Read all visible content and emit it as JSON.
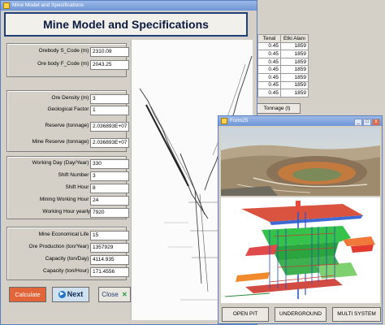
{
  "main_window": {
    "title": "Mine Model and Specifications",
    "heading": "Mine Model and Specifications"
  },
  "fields": {
    "orebody_s_code": {
      "label": "Orebody S_Code (m) :",
      "value": "2310.09"
    },
    "orebody_f_code": {
      "label": "Ore body F_Code (m) :",
      "value": "2043.25"
    },
    "ore_density": {
      "label": "Ore Density (m) :",
      "value": "3"
    },
    "geological_factor": {
      "label": "Geological Factor :",
      "value": "1"
    },
    "reserve": {
      "label": "Reserve (tonnage) :",
      "value": "2.036893E+07"
    },
    "mine_reserve": {
      "label": "Mine Reserve (tonnage) :",
      "value": "2.036893E+07"
    },
    "working_day": {
      "label": "Working Day (Day/Year) :",
      "value": "330"
    },
    "shift_number": {
      "label": "Shift Number :",
      "value": "3"
    },
    "shift_hour": {
      "label": "Shift Hour :",
      "value": "8"
    },
    "mining_working_hour": {
      "label": "Mining Working Hour :",
      "value": "24"
    },
    "working_hour_yearly": {
      "label": "Working Hour yearly:",
      "value": "7920"
    },
    "mine_economical_life": {
      "label": "Mine Economical Life :",
      "value": "15"
    },
    "ore_production": {
      "label": "Ore Production (ton/Year) :",
      "value": "1357929"
    },
    "capacity_day": {
      "label": "Capacity (ton/Day) :",
      "value": "4114.935"
    },
    "capacity_hour": {
      "label": "Capacity (ton/Hour) :",
      "value": "171.4556"
    }
  },
  "buttons": {
    "calculate": "Calculate",
    "next": "Next",
    "close": "Close"
  },
  "table": {
    "headers": [
      "Tenal",
      "Etki Alanı"
    ],
    "rows": [
      [
        "0.45",
        "1859"
      ],
      [
        "0.45",
        "1859"
      ],
      [
        "0.45",
        "1859"
      ],
      [
        "0.45",
        "1859"
      ],
      [
        "0.45",
        "1859"
      ],
      [
        "0.45",
        "1859"
      ],
      [
        "0.45",
        "1859"
      ]
    ],
    "tonnage_button": "Tonnage (t)"
  },
  "form25": {
    "title": "Form25",
    "buttons": {
      "open_pit": "OPEN PIT",
      "underground": "UNDERGROUND",
      "multi_system": "MULTI SYSTEM"
    }
  }
}
